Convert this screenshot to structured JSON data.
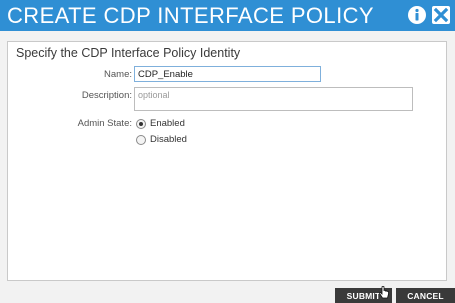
{
  "window": {
    "title": "CREATE CDP INTERFACE POLICY",
    "title_bar_color": "#2f8fd4",
    "info_icon": "info-icon",
    "close_icon": "close-icon"
  },
  "form": {
    "heading": "Specify the CDP Interface Policy Identity",
    "name": {
      "label": "Name:",
      "value": "CDP_Enable"
    },
    "description": {
      "label": "Description:",
      "value": "",
      "placeholder": "optional"
    },
    "admin_state": {
      "label": "Admin State:",
      "options": [
        {
          "label": "Enabled",
          "selected": true
        },
        {
          "label": "Disabled",
          "selected": false
        }
      ]
    }
  },
  "footer": {
    "submit_label": "SUBMIT",
    "cancel_label": "CANCEL",
    "button_color": "#3a3a3a"
  }
}
